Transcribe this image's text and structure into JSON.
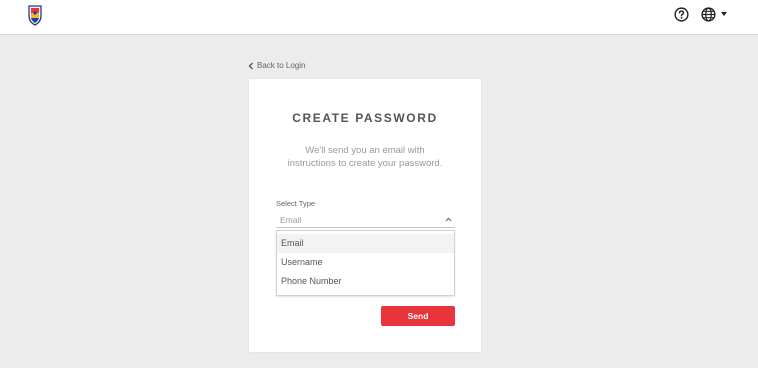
{
  "header": {
    "logo_icon": "crest-logo",
    "help_icon": "help-circle-icon",
    "language_icon": "globe-icon"
  },
  "nav": {
    "back_label": "Back to Login"
  },
  "card": {
    "title": "CREATE PASSWORD",
    "description_line1": "We'll send you an email with",
    "description_line2": "instructions to create your password.",
    "select_label": "Select Type",
    "select_value": "Email",
    "options": [
      {
        "label": "Email"
      },
      {
        "label": "Username"
      },
      {
        "label": "Phone Number"
      }
    ],
    "send_label": "Send"
  },
  "colors": {
    "accent": "#e8353b",
    "background": "#ececec"
  }
}
